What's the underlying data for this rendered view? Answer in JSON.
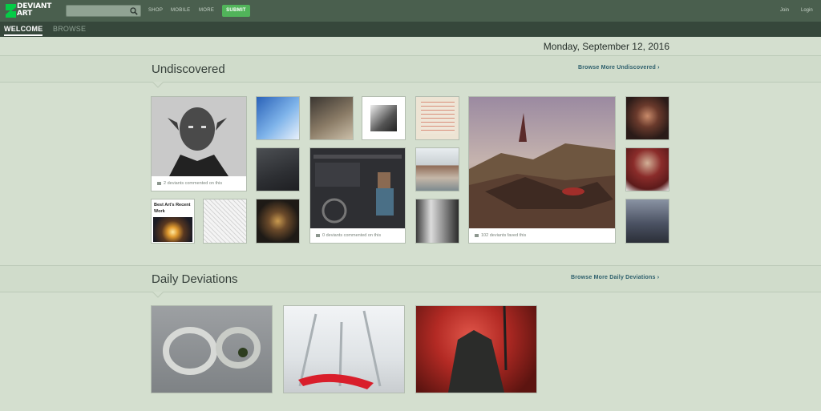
{
  "header": {
    "logo_text_line1": "DEVIANT",
    "logo_text_line2": "ART",
    "search_placeholder": "",
    "nav": [
      "SHOP",
      "MOBILE",
      "MORE"
    ],
    "submit_label": "SUBMIT",
    "join_label": "Join",
    "login_label": "Login",
    "colors": {
      "bar": "#4a5f4e",
      "submit": "#51b45a"
    }
  },
  "tabs": {
    "welcome": "WELCOME",
    "browse": "BROWSE"
  },
  "date": "Monday, September 12, 2016",
  "undiscovered": {
    "title": "Undiscovered",
    "browse_link": "Browse More Undiscovered",
    "captions": {
      "portrait": "2 deviants commented on this",
      "workshop": "0 deviants commented on this",
      "battlefield": "102 deviants faved this"
    },
    "best_art_title": "Best Art's Recent Work"
  },
  "daily": {
    "title": "Daily Deviations",
    "browse_link": "Browse More Daily Deviations"
  }
}
